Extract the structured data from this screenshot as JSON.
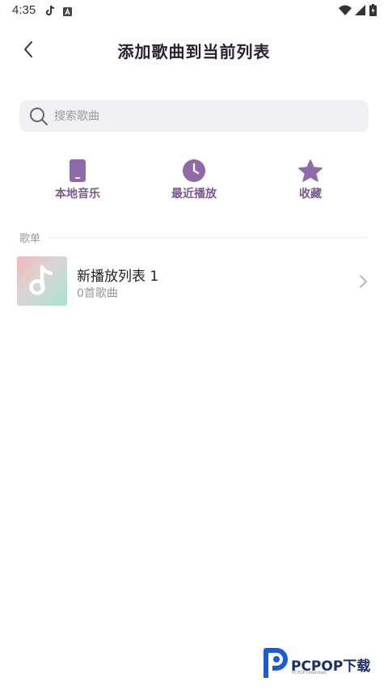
{
  "status_bar": {
    "time": "4:35",
    "left_icons": [
      "tiktok-icon",
      "a-badge-icon"
    ],
    "right_icons": [
      "wifi-icon",
      "signal-icon",
      "battery-icon"
    ]
  },
  "header": {
    "title": "添加歌曲到当前列表",
    "back_icon": "chevron-left-icon"
  },
  "search": {
    "placeholder": "搜索歌曲"
  },
  "shortcuts": [
    {
      "label": "本地音乐",
      "icon": "phone-icon"
    },
    {
      "label": "最近播放",
      "icon": "clock-icon"
    },
    {
      "label": "收藏",
      "icon": "star-icon"
    }
  ],
  "section": {
    "title": "歌单"
  },
  "playlists": [
    {
      "name": "新播放列表 1",
      "count": "0首歌曲",
      "icon": "music-note-icon"
    }
  ],
  "watermark": {
    "text": "PCPOP下载",
    "sub": "PCPOP Download"
  },
  "colors": {
    "accent": "#8e6aa8",
    "title": "#2a1f33",
    "search_bg": "#f1f1f3"
  }
}
